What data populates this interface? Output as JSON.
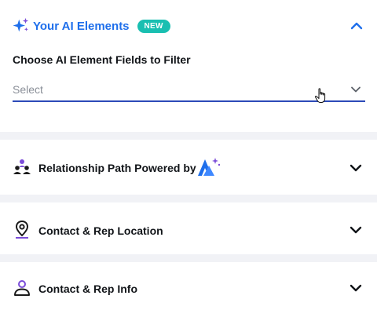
{
  "ai_section": {
    "title": "Your AI Elements",
    "badge": "NEW",
    "field_label": "Choose AI Element Fields to Filter",
    "select_placeholder": "Select",
    "icons": {
      "header": "sparkle-icon",
      "collapse": "chevron-up-icon",
      "select": "chevron-down-icon"
    }
  },
  "sections": [
    {
      "title": "Relationship Path Powered by",
      "icon": "people-network-icon",
      "brand_logo": "brand-logo-icon"
    },
    {
      "title": "Contact & Rep Location",
      "icon": "location-pin-icon"
    },
    {
      "title": "Contact & Rep Info",
      "icon": "person-icon"
    }
  ],
  "colors": {
    "accent_blue": "#1f6feb",
    "badge_teal": "#19bfb1",
    "underline": "#2c4ab8",
    "purple": "#7b4dd9"
  }
}
